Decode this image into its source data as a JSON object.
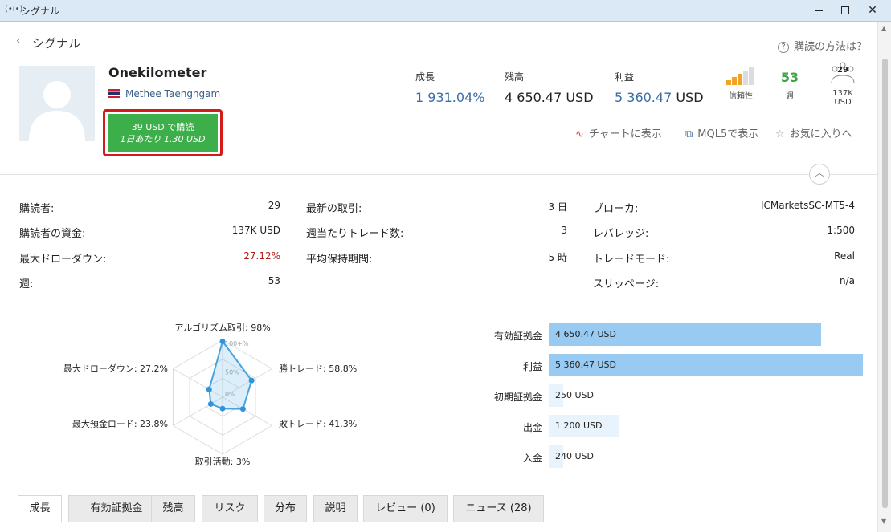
{
  "window": {
    "title": "シグナル"
  },
  "header": {
    "back_title": "シグナル",
    "howto_link": "購読の方法は？"
  },
  "signal": {
    "name": "Onekilometer",
    "author": "Methee Taengngam",
    "subscribe": {
      "line1": "39 USD で購読",
      "line2": "1日あたり 1.30 USD"
    }
  },
  "stats": {
    "growth": {
      "label": "成長",
      "value": "1 931.04%"
    },
    "balance": {
      "label": "残高",
      "value": "4 650.47 USD"
    },
    "profit": {
      "label": "利益",
      "value": "5 360.47 USD"
    },
    "reliability": {
      "label": "信頼性"
    },
    "weeks": {
      "label": "週",
      "value": "53"
    },
    "subscribers": {
      "count": "29",
      "funds": "137K USD"
    }
  },
  "actions": {
    "chart": "チャートに表示",
    "mql5": "MQL5で表示",
    "favorite": "お気に入りへ"
  },
  "info": {
    "col1": [
      {
        "label": "購読者:",
        "value": "29"
      },
      {
        "label": "購読者の資金:",
        "value": "137K USD"
      },
      {
        "label": "最大ドローダウン:",
        "value": "27.12%"
      },
      {
        "label": "週:",
        "value": "53"
      }
    ],
    "col2": [
      {
        "label": "最新の取引:",
        "value": "3 日"
      },
      {
        "label": "週当たりトレード数:",
        "value": "3"
      },
      {
        "label": "平均保持期間:",
        "value": "5 時"
      }
    ],
    "col3": [
      {
        "label": "ブローカ:",
        "value": "ICMarketsSC-MT5-4"
      },
      {
        "label": "レバレッジ:",
        "value": "1:500"
      },
      {
        "label": "トレードモード:",
        "value": "Real"
      },
      {
        "label": "スリッページ:",
        "value": "n/a"
      }
    ]
  },
  "radar": {
    "ticks": [
      "100+%",
      "50%",
      "0%"
    ],
    "axes": [
      {
        "label": "アルゴリズム取引: 98%",
        "value": 0.98
      },
      {
        "label": "勝トレード: 58.8%",
        "value": 0.588
      },
      {
        "label": "敗トレード: 41.3%",
        "value": 0.413
      },
      {
        "label": "取引活動: 3%",
        "value": 0.03
      },
      {
        "label": "最大預金ロード: 23.8%",
        "value": 0.238
      },
      {
        "label": "最大ドローダウン: 27.2%",
        "value": 0.272
      }
    ]
  },
  "chart_data": {
    "type": "bar",
    "orientation": "horizontal",
    "categories": [
      "有効証拠金",
      "利益",
      "初期証拠金",
      "出金",
      "入金"
    ],
    "values": [
      4650.47,
      5360.47,
      250,
      1200,
      240
    ],
    "value_labels": [
      "4 650.47 USD",
      "5 360.47 USD",
      "250 USD",
      "1 200 USD",
      "240 USD"
    ],
    "colors": [
      "#99cbf2",
      "#99cbf2",
      "#e8f3fb",
      "#e8f3fb",
      "#e8f3fb"
    ]
  },
  "tabs": [
    "成長",
    "有効証拠金",
    "残高",
    "リスク",
    "分布",
    "説明",
    "レビュー (0)",
    "ニュース (28)"
  ],
  "colors": {
    "subscribe_green": "#3cae4a",
    "highlight_red": "#d51a1a",
    "growth_blue": "#3a6ea5",
    "drawdown_red": "#b31b1b",
    "weeks_green": "#3ca544"
  }
}
